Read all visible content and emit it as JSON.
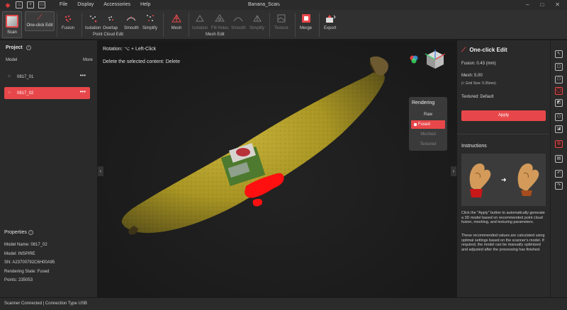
{
  "window": {
    "title": "Banana_Scan",
    "menu": [
      "File",
      "Display",
      "Accessories",
      "Help"
    ]
  },
  "ribbon": {
    "scan_label": "Scan",
    "one_click_label": "One-click Edit",
    "point_cloud_buttons": [
      "Fusion",
      "Isolation",
      "Overlap",
      "Smooth",
      "Simplify"
    ],
    "point_cloud_group": "Point Cloud Edit",
    "mesh_buttons": [
      "Mesh",
      "Isolation",
      "Fill Holes",
      "Smooth",
      "Simplify"
    ],
    "mesh_group": "Mesh Edit",
    "texture_label": "Texture",
    "merge_label": "Merge",
    "export_label": "Export"
  },
  "project": {
    "title": "Project",
    "model_label": "Model",
    "more_label": "More",
    "models": [
      {
        "name": "0817_01",
        "active": false
      },
      {
        "name": "0817_02",
        "active": true
      }
    ]
  },
  "properties": {
    "title": "Properties",
    "items": [
      "Model Name:  0817_02",
      "Model:  INSPIRE",
      "SN:  A23700792C6H00A95",
      "Rendering State:  Fused",
      "Points:  235053"
    ]
  },
  "viewport": {
    "hint_rotation": "Rotation: ⌥ + Left-Click",
    "hint_delete": "Delete the selected content: Delete"
  },
  "rendering": {
    "title": "Rendering",
    "options": [
      {
        "label": "Raw",
        "state": "normal"
      },
      {
        "label": "Fused",
        "state": "selected"
      },
      {
        "label": "Meshed",
        "state": "disabled"
      },
      {
        "label": "Textured",
        "state": "disabled"
      }
    ]
  },
  "one_click": {
    "title": "One-click Edit",
    "fusion": "Fusion:   0.43 (mm)",
    "mesh": "Mesh:   5.00",
    "grid": "(≈ Grid Size: 0.35mm)",
    "textured": "Textured:    Default",
    "apply_label": "Apply",
    "instructions_title": "Instructions",
    "instructions_p1": "Click the \"Apply\" button to automatically generate a 3D model based on recommended point cloud fusion, meshing, and texturing parameters.",
    "instructions_p2": "These recommended values are calculated using optimal settings based on the scanner's model. If required, the model can be manually optimized and adjusted after the processing has finished."
  },
  "status": {
    "text": "Scanner Connected | Connection Type USB"
  },
  "colors": {
    "accent": "#e7474a",
    "panel": "#2a2a2a",
    "viewport": "#1e1e1e"
  }
}
